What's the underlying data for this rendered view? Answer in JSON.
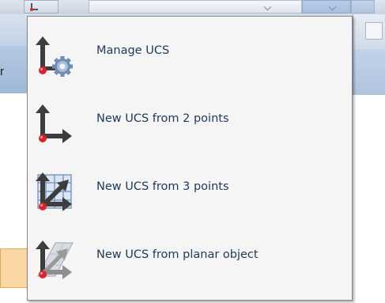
{
  "background": {
    "partial_text": "r"
  },
  "menu": {
    "items": [
      {
        "label": "Manage UCS",
        "icon": "manage-ucs-icon"
      },
      {
        "label": "New UCS from 2 points",
        "icon": "ucs-2-points-icon"
      },
      {
        "label": "New UCS from 3 points",
        "icon": "ucs-3-points-icon"
      },
      {
        "label": "New UCS from planar object",
        "icon": "ucs-planar-object-icon"
      }
    ]
  },
  "colors": {
    "menu_background": "#f5f5f5",
    "menu_border": "#868686",
    "label_text": "#1e395b",
    "axis_dark": "#3d3d3d",
    "origin_red": "#d9262d",
    "gear_blue": "#6f8db4"
  }
}
